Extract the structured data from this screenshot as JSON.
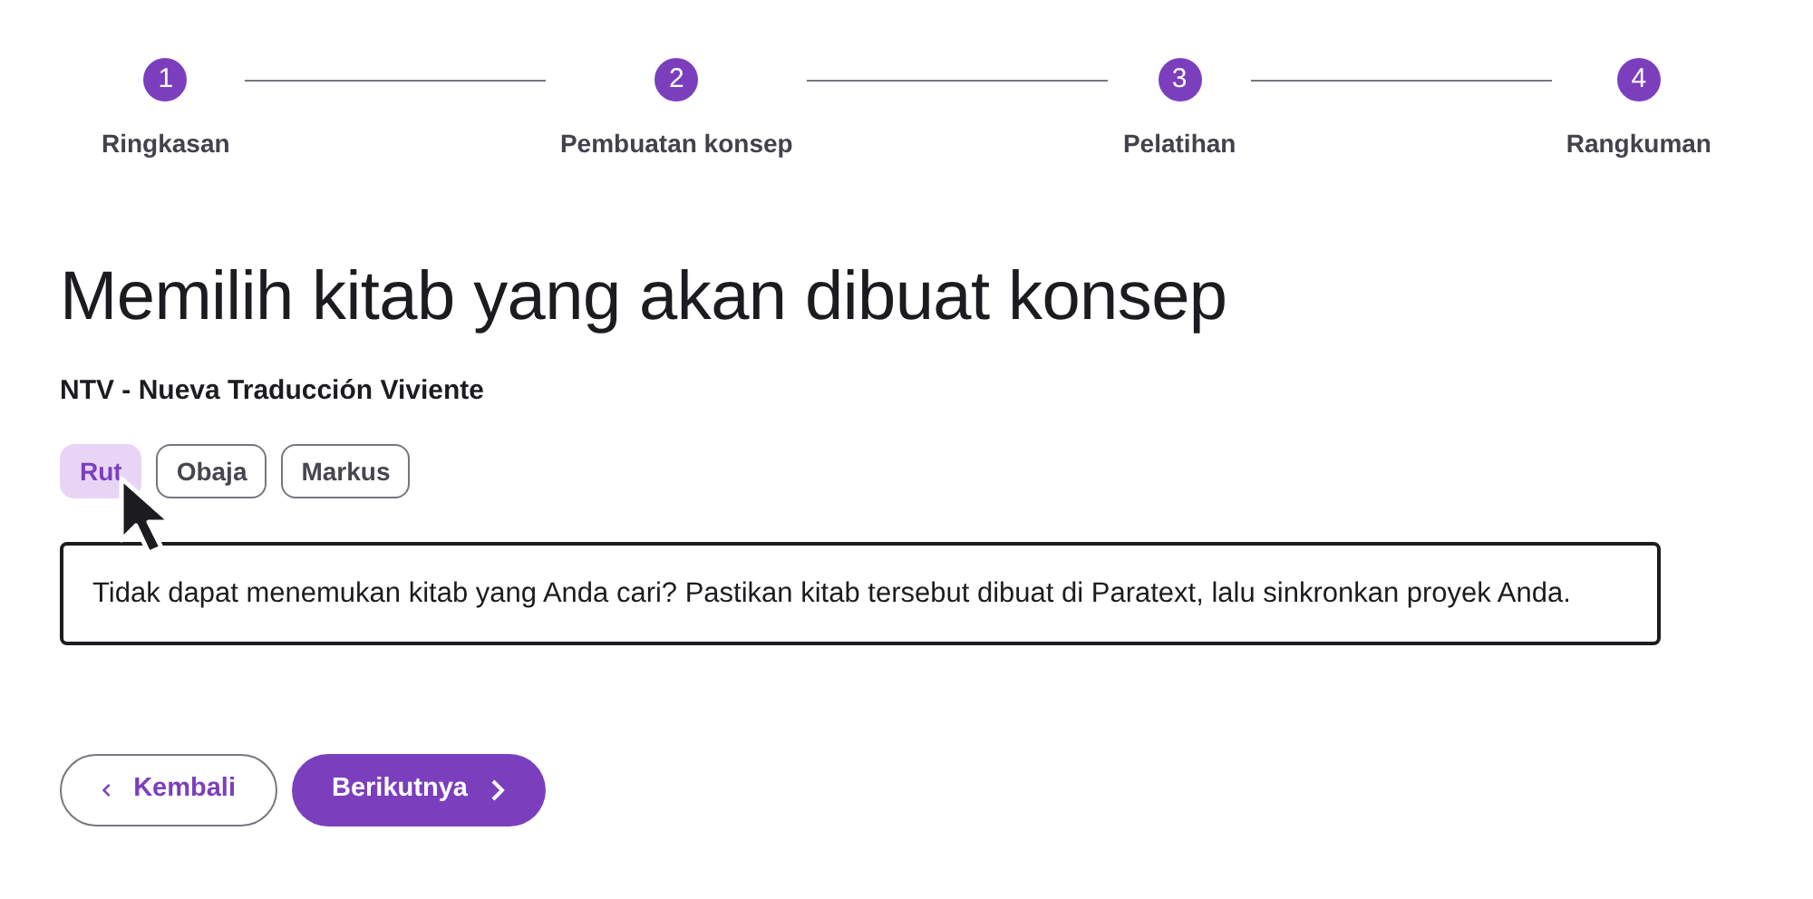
{
  "stepper": [
    {
      "number": "1",
      "label": "Ringkasan"
    },
    {
      "number": "2",
      "label": "Pembuatan konsep"
    },
    {
      "number": "3",
      "label": "Pelatihan"
    },
    {
      "number": "4",
      "label": "Rangkuman"
    }
  ],
  "title": "Memilih kitab yang akan dibuat konsep",
  "project": "NTV - Nueva Traducción Viviente",
  "books": [
    {
      "label": "Rut",
      "selected": true
    },
    {
      "label": "Obaja",
      "selected": false
    },
    {
      "label": "Markus",
      "selected": false
    }
  ],
  "notice": "Tidak dapat menemukan kitab yang Anda cari? Pastikan kitab tersebut dibuat di Paratext, lalu sinkronkan proyek Anda.",
  "buttons": [
    {
      "kind": "back",
      "label": "Kembali"
    },
    {
      "kind": "next",
      "label": "Berikutnya"
    }
  ]
}
